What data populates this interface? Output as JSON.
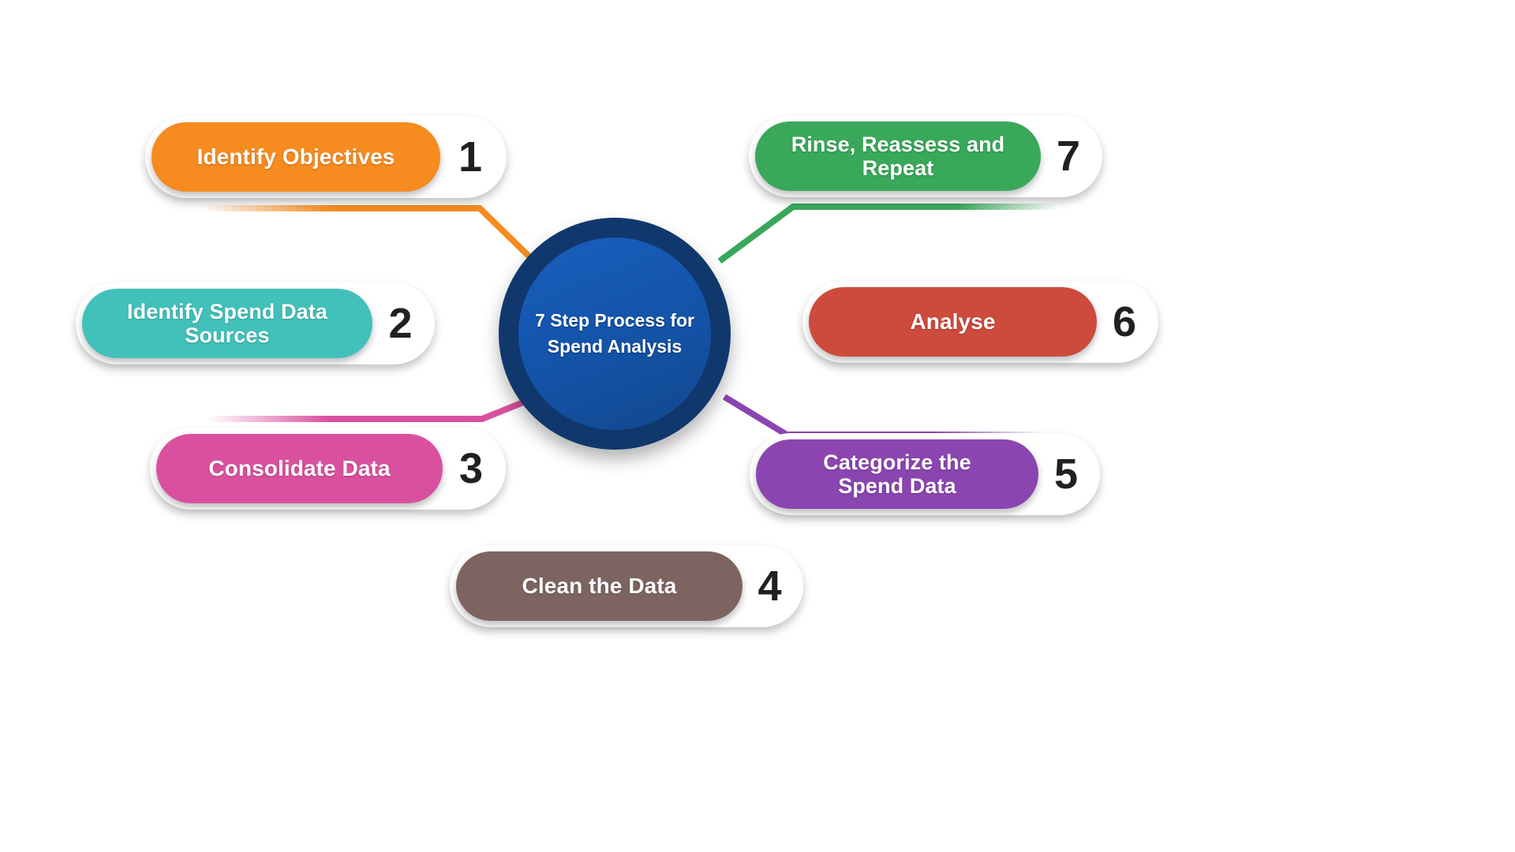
{
  "diagram": {
    "title": "7 Step Process for Spend Analysis",
    "center": {
      "label": "7 Step Process for\nSpend Analysis",
      "ring_color": "#10386D",
      "fill_color": "#1558B0",
      "text_color": "#FFFFFF"
    },
    "background_color": "#FFFFFF",
    "number_text_color": "#231F20",
    "badge_background": "#FFFFFF",
    "steps": [
      {
        "number": "1",
        "label": "Identify Objectives",
        "color": "#F68B1F",
        "side": "left",
        "lines": 1
      },
      {
        "number": "2",
        "label": "Identify Spend Data\nSources",
        "color": "#41C1BA",
        "side": "left",
        "lines": 2
      },
      {
        "number": "3",
        "label": "Consolidate Data",
        "color": "#D9519E",
        "side": "left",
        "lines": 1
      },
      {
        "number": "4",
        "label": "Clean the Data",
        "color": "#7D6460",
        "side": "bottom",
        "lines": 1
      },
      {
        "number": "5",
        "label": "Categorize the\nSpend Data",
        "color": "#8B45B0",
        "side": "right",
        "lines": 2
      },
      {
        "number": "6",
        "label": "Analyse",
        "color": "#CC4B3C",
        "side": "right",
        "lines": 1
      },
      {
        "number": "7",
        "label": "Rinse, Reassess and\nRepeat",
        "color": "#39A85B",
        "side": "right",
        "lines": 2
      }
    ]
  }
}
